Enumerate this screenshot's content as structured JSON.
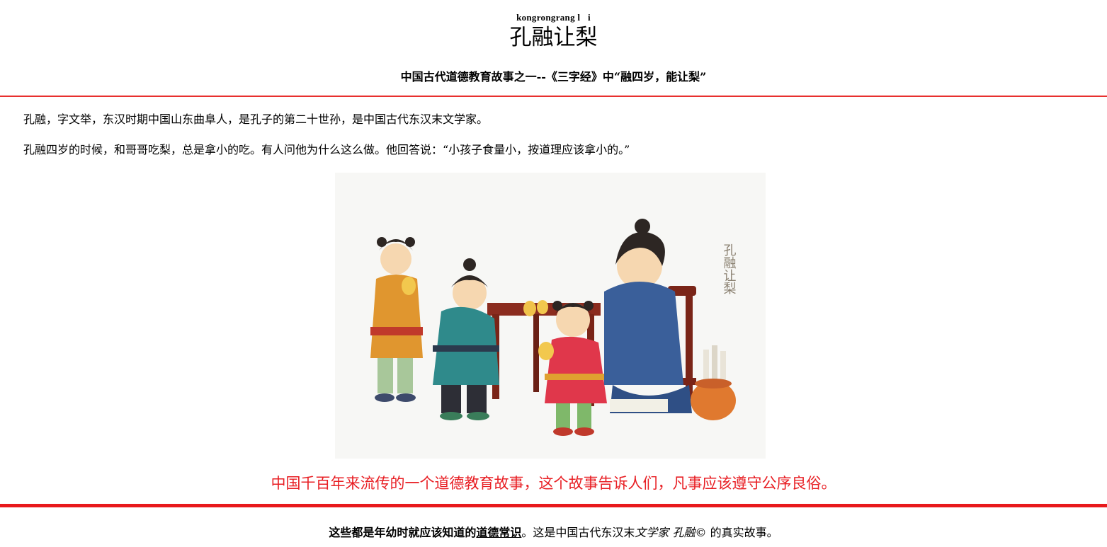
{
  "header": {
    "pinyin": "kongrongrang l   i",
    "title": "孔融让梨",
    "subtitle": "中国古代道德教育故事之一--《三字经》中“融四岁，能让梨”"
  },
  "content": {
    "paragraph_1": "孔融，字文举，东汉时期中国山东曲阜人，是孔子的第二十世孙，是中国古代东汉末文学家。",
    "paragraph_2": "孔融四岁的时候，和哥哥吃梨，总是拿小的吃。有人问他为什么这么做。他回答说：“小孩子食量小，按道理应该拿小的。”",
    "illustration_caption": "孔融让梨",
    "moral": "中国千百年来流传的一个道德教育故事，这个故事告诉人们，凡事应该遵守公序良俗。"
  },
  "footer": {
    "bold_text": "这些都是年幼时就应该知道的",
    "link_text": "道德常识",
    "middle_text": "。这是中国古代东汉末",
    "italic_text": "文学家 孔融",
    "symbol": "©",
    "end_text": " 的真实故事。"
  },
  "colors": {
    "accent_red": "#e8191c",
    "moral_text": "#e81f24"
  }
}
